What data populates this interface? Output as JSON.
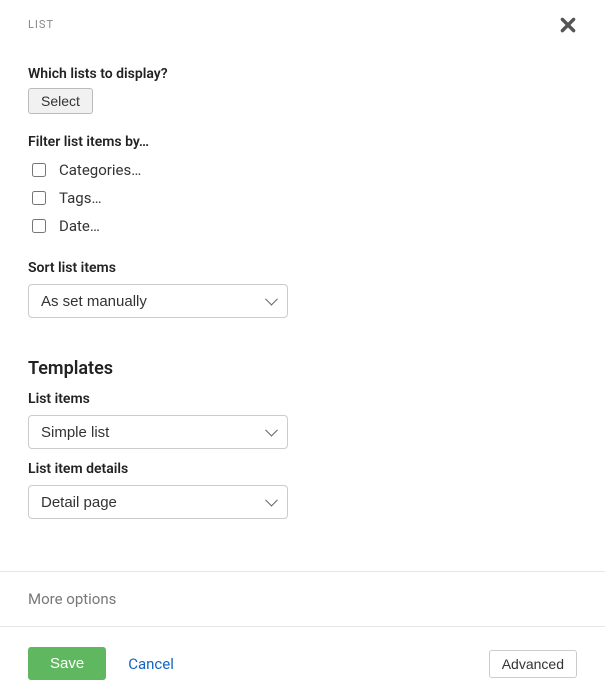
{
  "header": {
    "title": "LIST"
  },
  "sections": {
    "which_lists": {
      "label": "Which lists to display?",
      "select_button": "Select"
    },
    "filter": {
      "label": "Filter list items by…",
      "items": [
        {
          "label": "Categories…",
          "checked": false
        },
        {
          "label": "Tags…",
          "checked": false
        },
        {
          "label": "Date…",
          "checked": false
        }
      ]
    },
    "sort": {
      "label": "Sort list items",
      "value": "As set manually"
    },
    "templates": {
      "heading": "Templates",
      "list_items": {
        "label": "List items",
        "value": "Simple list"
      },
      "list_details": {
        "label": "List item details",
        "value": "Detail page"
      }
    }
  },
  "more_options": "More options",
  "footer": {
    "save": "Save",
    "cancel": "Cancel",
    "advanced": "Advanced"
  }
}
